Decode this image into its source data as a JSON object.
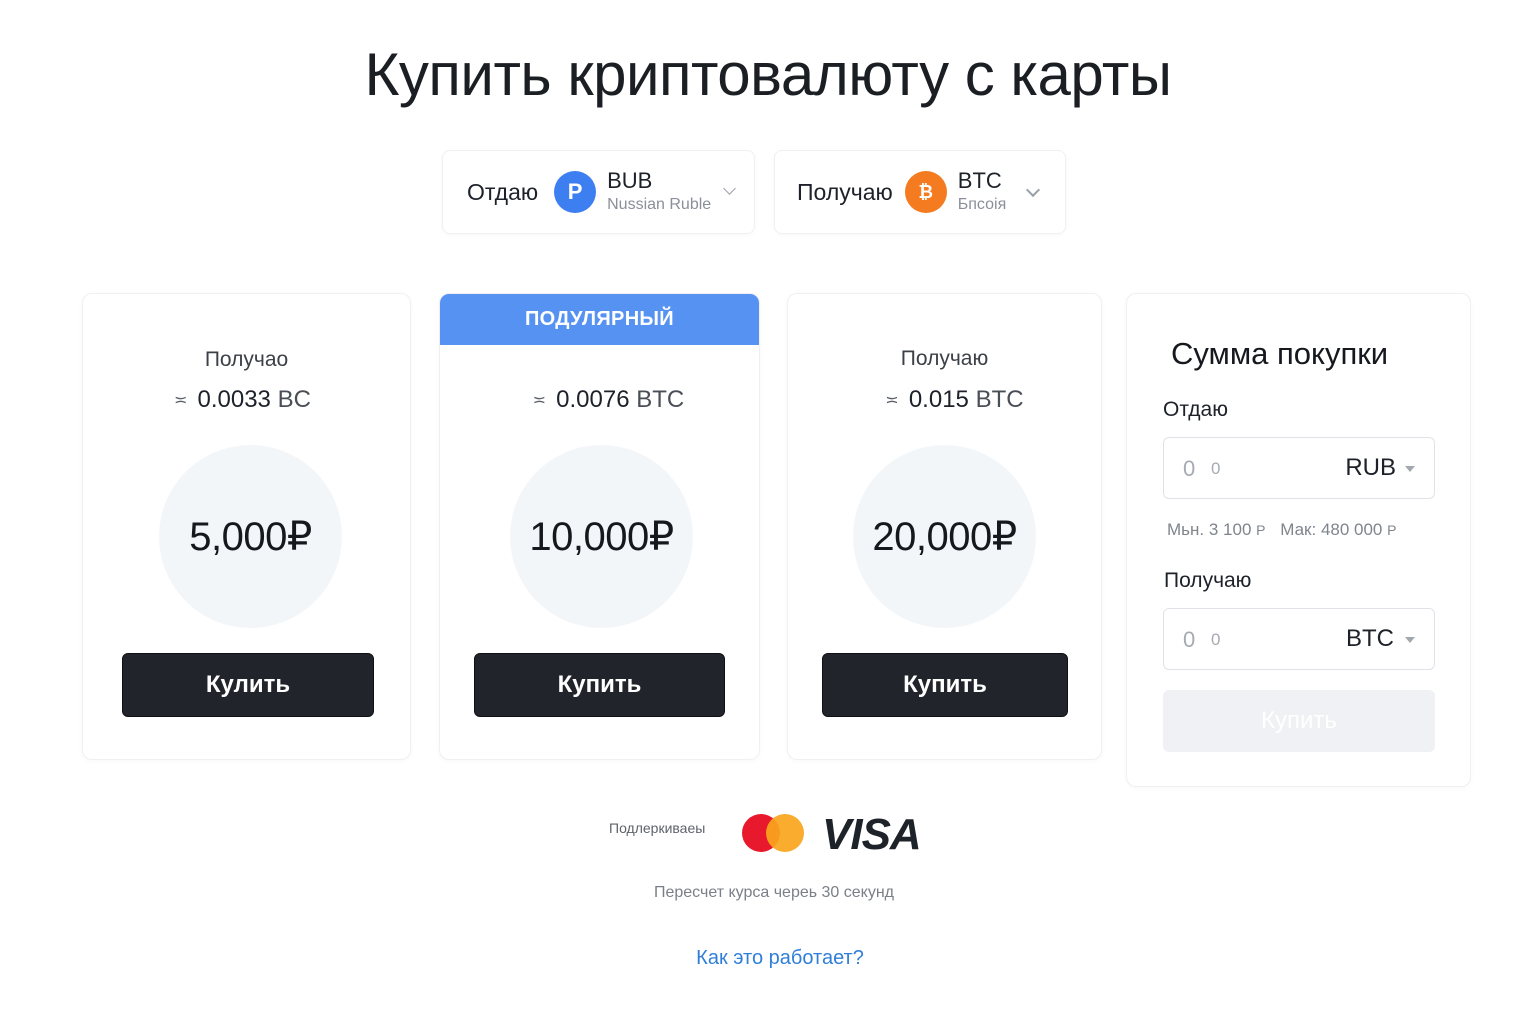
{
  "page": {
    "title": "Купить криптовалюту с карты"
  },
  "selectors": {
    "give": {
      "label": "Отдаю",
      "icon_glyph": "P",
      "icon_color": "#3d7ff0",
      "code": "BUB",
      "name": "Nussian Ruble"
    },
    "get": {
      "label": "Получаю",
      "icon_glyph": "₿",
      "icon_color": "#f47b20",
      "code": "BTC",
      "name": "Бпсоія"
    }
  },
  "plans": [
    {
      "receive_label": "Получао",
      "approx_symbol": "≍",
      "approx_value": "0.0033",
      "approx_unit": "BC",
      "amount": "5,000₽",
      "button": "Кулить"
    },
    {
      "badge": "ПОДУЛЯРНЫЙ",
      "badge_color": "#5592f2",
      "approx_symbol": "≍",
      "approx_value": "0.0076",
      "approx_unit": "BTC",
      "amount": "10,000₽",
      "button": "Купить"
    },
    {
      "receive_label": "Получаю",
      "approx_symbol": "≍",
      "approx_value": "0.015",
      "approx_unit": "BTC",
      "amount": "20,000₽",
      "button": "Купить"
    }
  ],
  "panel": {
    "title": "Сумма покупки",
    "give": {
      "label": "Отдаю",
      "placeholder": "0",
      "placeholder_small": "0",
      "currency": "RUB"
    },
    "limits": {
      "min_label": "Мьн.",
      "min_value": "3 100",
      "max_label": "Мак:",
      "max_value": "480 000",
      "currency_symbol": "Р"
    },
    "get": {
      "label": "Получаю",
      "placeholder": "0",
      "placeholder_small": "0",
      "currency": "BTC"
    },
    "button": "Купить",
    "button_state": "disabled"
  },
  "footer": {
    "supported_label": "Подлеркиваеы",
    "payment_icons": [
      "mastercard-icon",
      "visa-icon"
    ],
    "visa_text": "VISA",
    "refresh_note": "Пересчет курса черeь 30 секунд",
    "how_link": "Как это работает?"
  },
  "colors": {
    "accent_blue": "#5592f2",
    "button_dark": "#21242a",
    "link": "#2f7fd8"
  }
}
